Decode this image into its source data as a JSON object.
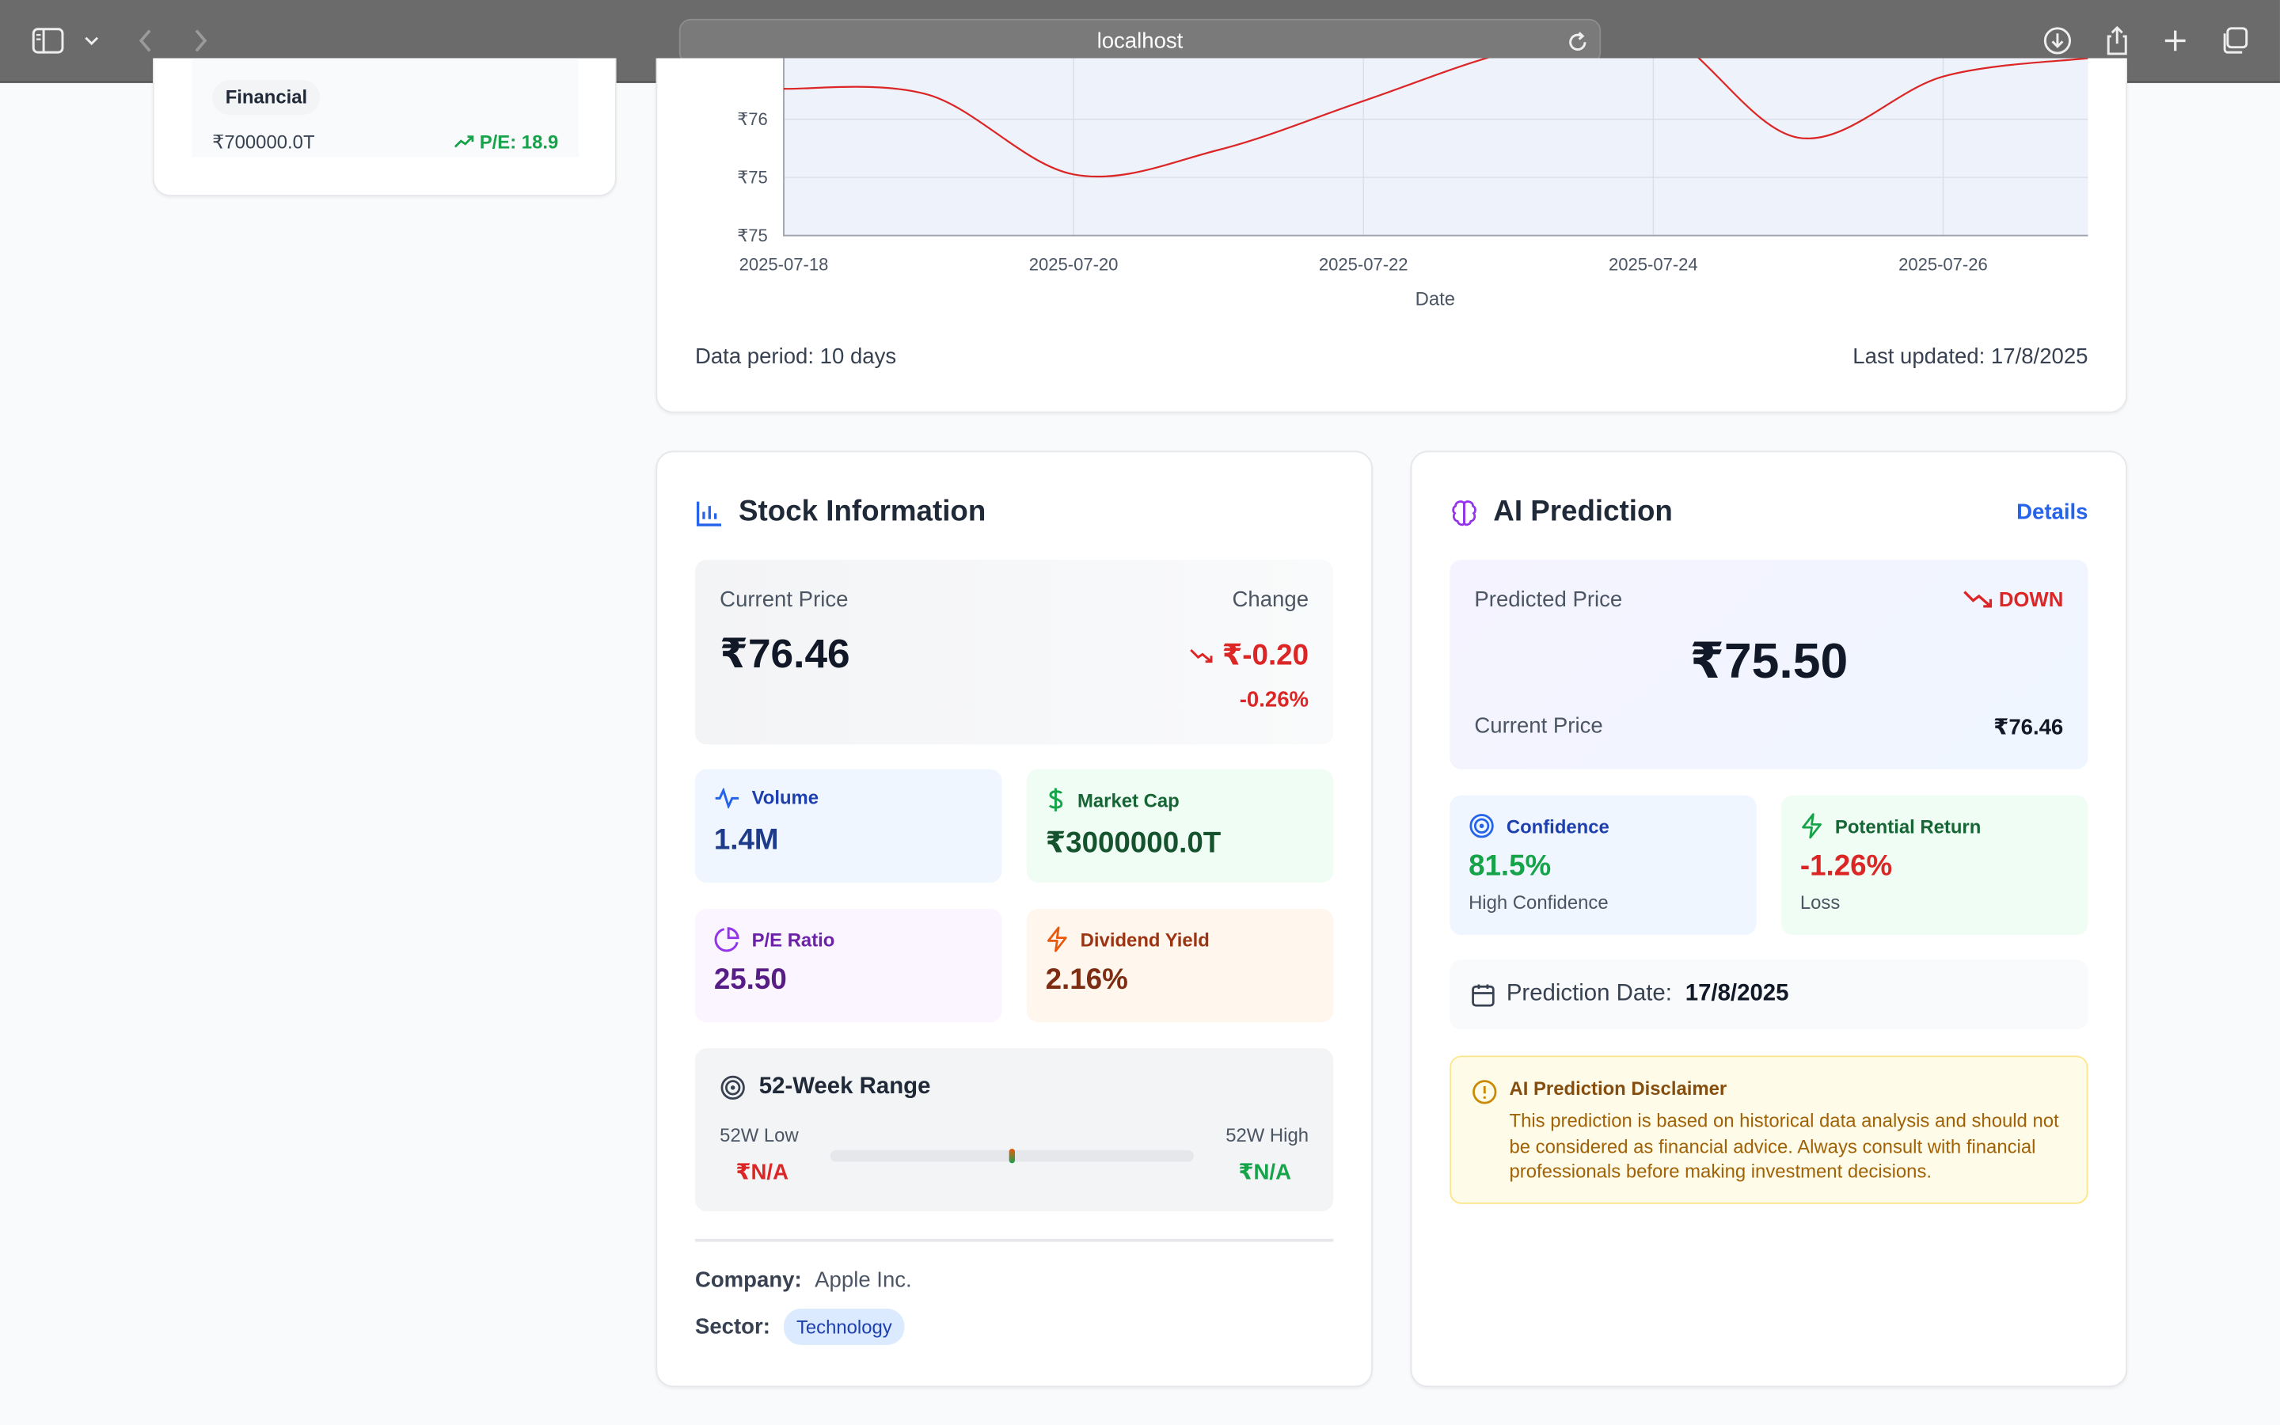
{
  "browser": {
    "url": "localhost"
  },
  "left_card": {
    "tag": "Financial",
    "market_cap": "₹700000.0T",
    "pe": "P/E: 18.9"
  },
  "chart_data": {
    "type": "line",
    "x": [
      "2025-07-18",
      "2025-07-19",
      "2025-07-20",
      "2025-07-21",
      "2025-07-22",
      "2025-07-23",
      "2025-07-24",
      "2025-07-25",
      "2025-07-26",
      "2025-07-27"
    ],
    "xticks": [
      "2025-07-18",
      "2025-07-20",
      "2025-07-22",
      "2025-07-24",
      "2025-07-26"
    ],
    "yticks": [
      "₹76",
      "₹75",
      "₹75"
    ],
    "xlabel": "Date",
    "series": [
      {
        "values": [
          76.1,
          76.05,
          75.4,
          75.6,
          76.0,
          76.4,
          76.6,
          75.7,
          76.2,
          76.35
        ],
        "color": "#dc2626"
      }
    ]
  },
  "chart_footer": {
    "period": "Data period: 10 days",
    "updated": "Last updated: 17/8/2025"
  },
  "stock": {
    "title": "Stock Information",
    "current_price_label": "Current Price",
    "current_price": "₹76.46",
    "change_label": "Change",
    "change": "₹-0.20",
    "change_pct": "-0.26%",
    "volume_label": "Volume",
    "volume": "1.4M",
    "market_cap_label": "Market Cap",
    "market_cap": "₹3000000.0T",
    "pe_label": "P/E Ratio",
    "pe": "25.50",
    "div_label": "Dividend Yield",
    "div": "2.16%",
    "range_title": "52-Week Range",
    "low_label": "52W Low",
    "low": "₹N/A",
    "high_label": "52W High",
    "high": "₹N/A",
    "range_position": 0.5,
    "company_label": "Company:",
    "company": "Apple Inc.",
    "sector_label": "Sector:",
    "sector": "Technology"
  },
  "ai": {
    "title": "AI Prediction",
    "details": "Details",
    "predicted_label": "Predicted Price",
    "direction": "DOWN",
    "predicted": "₹75.50",
    "current_label": "Current Price",
    "current": "₹76.46",
    "confidence_label": "Confidence",
    "confidence": "81.5%",
    "confidence_desc": "High Confidence",
    "return_label": "Potential Return",
    "return": "-1.26%",
    "return_desc": "Loss",
    "date_label": "Prediction Date:",
    "date": "17/8/2025",
    "disclaimer_title": "AI Prediction Disclaimer",
    "disclaimer_text": "This prediction is based on historical data analysis and should not be considered as financial advice. Always consult with financial professionals before making investment decisions."
  },
  "colors": {
    "up": "#16a34a",
    "down": "#dc2626",
    "accent": "#2563eb"
  }
}
